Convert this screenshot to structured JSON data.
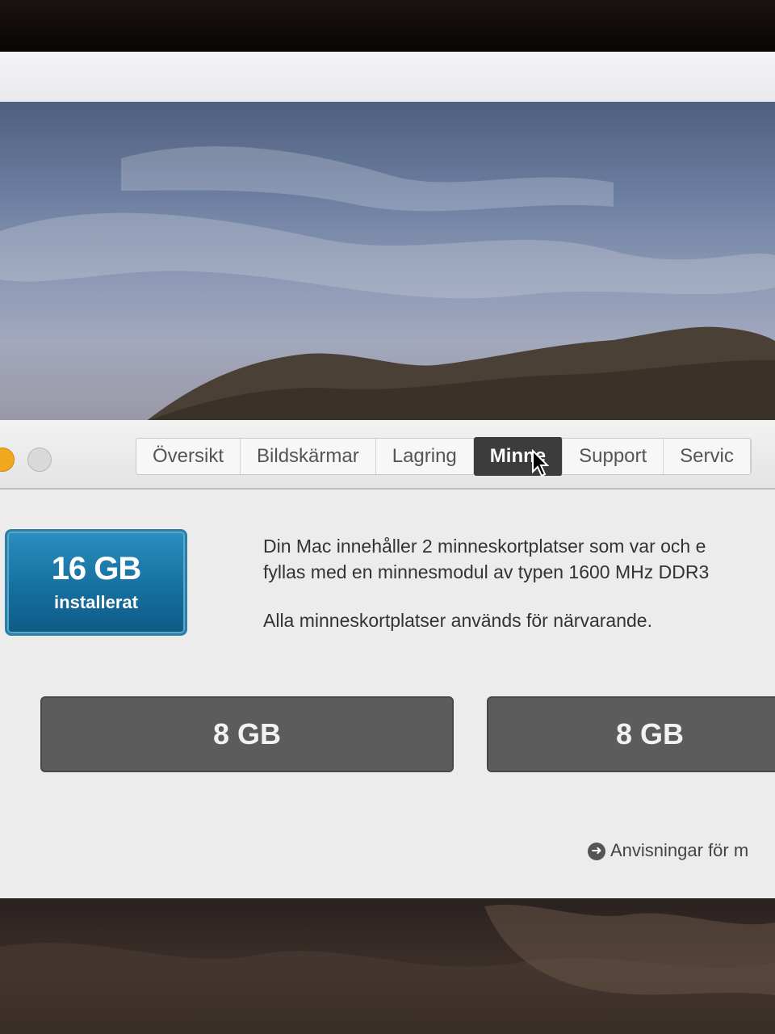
{
  "tabs": [
    {
      "label": "Översikt"
    },
    {
      "label": "Bildskärmar"
    },
    {
      "label": "Lagring"
    },
    {
      "label": "Minne"
    },
    {
      "label": "Support"
    },
    {
      "label": "Servic"
    }
  ],
  "memory": {
    "total": "16 GB",
    "total_label": "installerat",
    "description_line1": "Din Mac innehåller 2 minneskortplatser som var och e",
    "description_line2": "fyllas med en minnesmodul av typen 1600 MHz DDR3",
    "description_line3": "Alla minneskortplatser används för närvarande.",
    "slots": [
      "8 GB",
      "8 GB"
    ],
    "link": "Anvisningar för m"
  },
  "colors": {
    "badge": "#1670a0",
    "slot": "#5c5c5c",
    "active_tab": "#3c3c3c"
  }
}
